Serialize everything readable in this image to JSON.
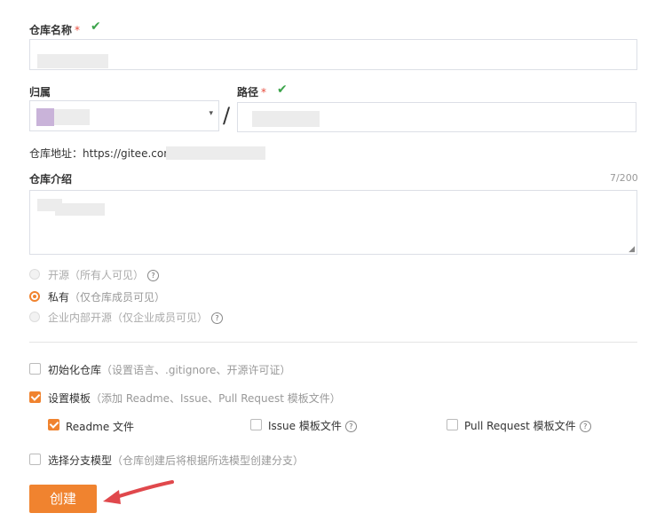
{
  "repo_name": {
    "label": "仓库名称",
    "required_mark": "*"
  },
  "owner": {
    "label": "归属"
  },
  "path": {
    "label": "路径",
    "required_mark": "*",
    "separator": "/"
  },
  "repo_address": {
    "label": "仓库地址：",
    "prefix": "https://gitee.com/"
  },
  "description": {
    "label": "仓库介绍",
    "counter": "7/200"
  },
  "visibility": {
    "options": [
      {
        "label": "开源",
        "hint": "（所有人可见）",
        "state": "disabled"
      },
      {
        "label": "私有",
        "hint": "（仅仓库成员可见）",
        "state": "selected"
      },
      {
        "label": "企业内部开源",
        "hint": "（仅企业成员可见）",
        "state": "disabled"
      }
    ]
  },
  "init_repo": {
    "label": "初始化仓库",
    "hint": "（设置语言、.gitignore、开源许可证）",
    "checked": false
  },
  "templates": {
    "label": "设置模板",
    "hint": "（添加 Readme、Issue、Pull Request 模板文件）",
    "checked": true,
    "items": [
      {
        "label": "Readme 文件",
        "checked": true
      },
      {
        "label": "Issue 模板文件",
        "checked": false
      },
      {
        "label": "Pull Request 模板文件",
        "checked": false
      }
    ]
  },
  "branch_model": {
    "label": "选择分支模型",
    "hint": "（仓库创建后将根据所选模型创建分支）",
    "checked": false
  },
  "submit": {
    "label": "创建"
  },
  "colors": {
    "accent": "#f0832f",
    "arrow": "#e0484c",
    "success": "#3ca44b"
  }
}
